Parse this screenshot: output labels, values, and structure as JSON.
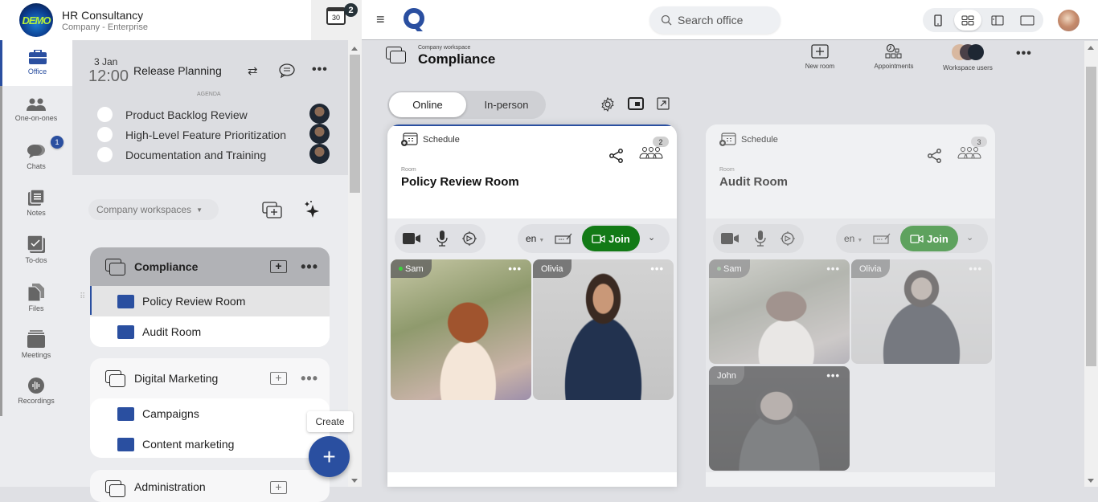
{
  "brand": {
    "name": "HR Consultancy",
    "subtitle": "Company - Enterprise",
    "logo_text": "DEMO"
  },
  "calendar": {
    "day": "30",
    "badge": "2"
  },
  "rail": {
    "items": [
      {
        "label": "Office",
        "icon": "briefcase-icon",
        "active": true
      },
      {
        "label": "One-on-ones",
        "icon": "people-icon"
      },
      {
        "label": "Chats",
        "icon": "chat-icon",
        "badge": "1"
      },
      {
        "label": "Notes",
        "icon": "notes-icon"
      },
      {
        "label": "To-dos",
        "icon": "todo-icon"
      },
      {
        "label": "Files",
        "icon": "files-icon"
      },
      {
        "label": "Meetings",
        "icon": "meetings-icon"
      },
      {
        "label": "Recordings",
        "icon": "recordings-icon"
      }
    ]
  },
  "meeting": {
    "date": "3 Jan",
    "time": "12:00",
    "title": "Release Planning",
    "agenda_label": "AGENDA",
    "agenda": [
      {
        "item": "Product Backlog Review"
      },
      {
        "item": "High-Level Feature Prioritization"
      },
      {
        "item": "Documentation and Training"
      }
    ]
  },
  "workspaces": {
    "filter_label": "Company workspaces",
    "groups": [
      {
        "name": "Compliance",
        "rooms": [
          "Policy Review Room",
          "Audit Room"
        ]
      },
      {
        "name": "Digital Marketing",
        "rooms": [
          "Campaigns",
          "Content marketing"
        ]
      },
      {
        "name": "Administration",
        "rooms": []
      }
    ]
  },
  "create_tooltip": "Create",
  "topbar": {
    "search_placeholder": "Search office"
  },
  "workspace_header": {
    "caption": "Company workspace",
    "title": "Compliance",
    "tools": [
      {
        "label": "New room",
        "icon": "new-room-icon"
      },
      {
        "label": "Appointments",
        "icon": "appointments-icon"
      },
      {
        "label": "Workspace users",
        "icon": "workspace-users-icon"
      }
    ]
  },
  "mode_tabs": {
    "online": "Online",
    "in_person": "In-person"
  },
  "rooms": [
    {
      "schedule_label": "Schedule",
      "room_label": "Room",
      "name": "Policy Review Room",
      "participant_count": "2",
      "language": "en",
      "join_label": "Join",
      "join_color": "#127a16",
      "participants": [
        {
          "name": "Sam",
          "online": true
        },
        {
          "name": "Olivia",
          "online": false
        }
      ]
    },
    {
      "schedule_label": "Schedule",
      "room_label": "Room",
      "name": "Audit Room",
      "participant_count": "3",
      "language": "en",
      "join_label": "Join",
      "join_color": "#5ea25e",
      "participants": [
        {
          "name": "Sam",
          "online": true
        },
        {
          "name": "Olivia",
          "online": false
        },
        {
          "name": "John",
          "online": false
        }
      ]
    }
  ]
}
